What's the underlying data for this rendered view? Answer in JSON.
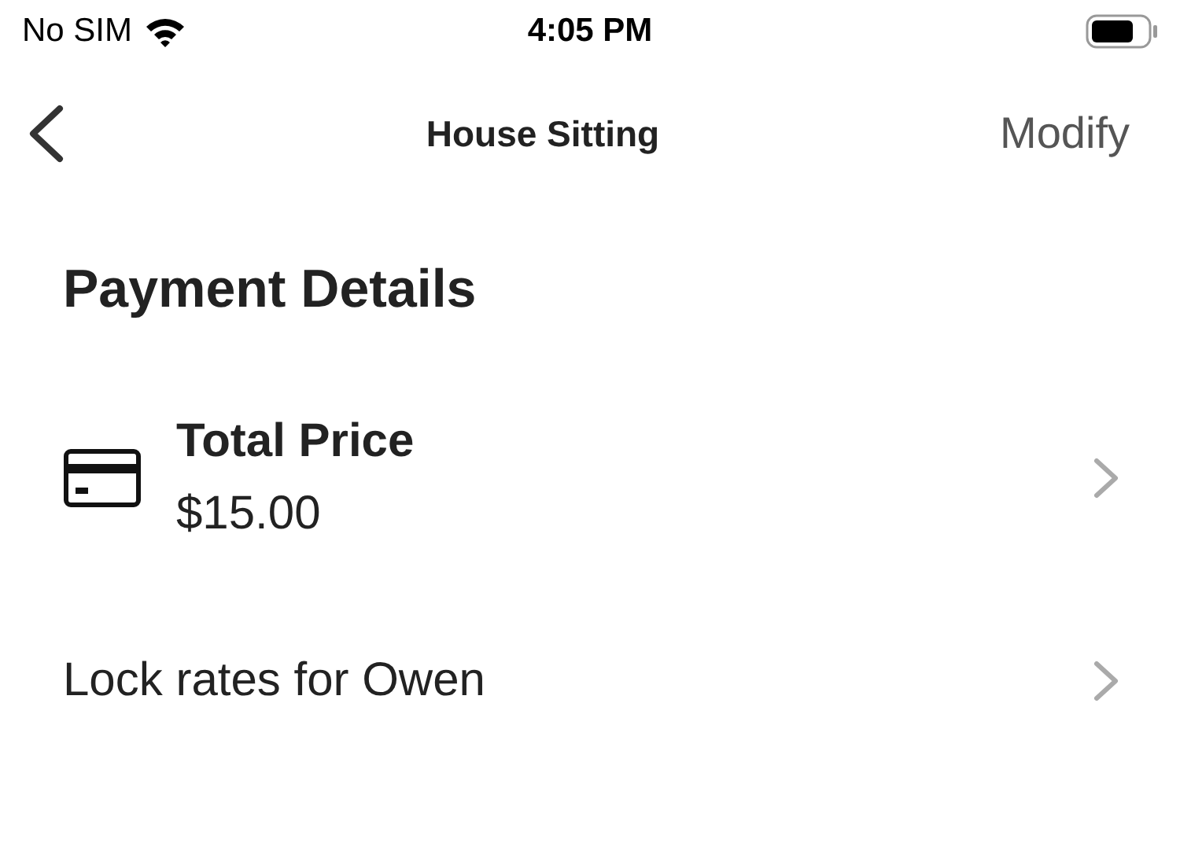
{
  "status_bar": {
    "carrier": "No SIM",
    "time": "4:05 PM"
  },
  "nav": {
    "title": "House Sitting",
    "action": "Modify"
  },
  "heading": "Payment Details",
  "rows": [
    {
      "kind": "price",
      "title": "Total Price",
      "value": "$15.00"
    },
    {
      "kind": "plain",
      "title": "Lock rates for Owen"
    }
  ]
}
